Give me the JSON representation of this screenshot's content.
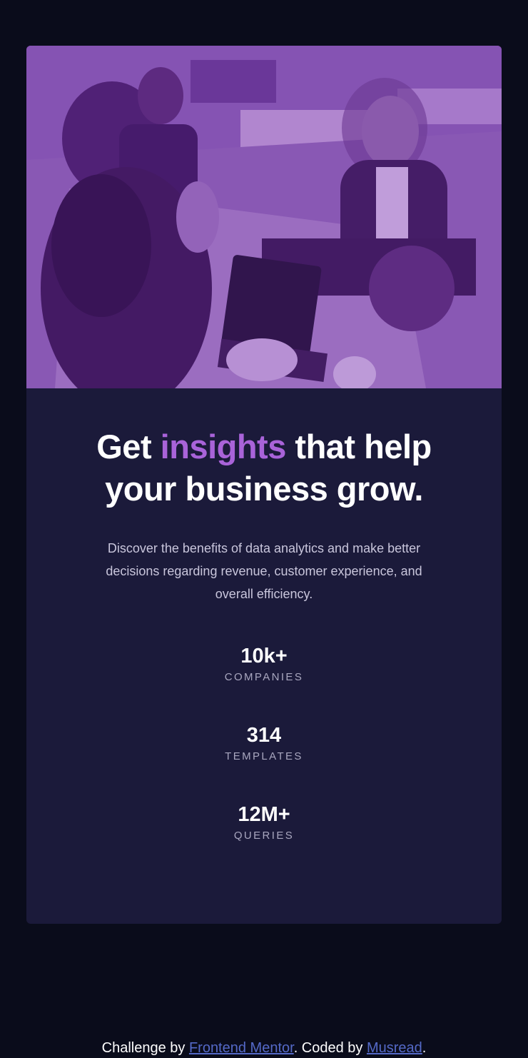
{
  "hero": {
    "alt": "Team working at a shared desk with laptops"
  },
  "headline": {
    "part1": "Get ",
    "accent": "insights",
    "part2": " that help your business grow."
  },
  "description": "Discover the benefits of data analytics and make better decisions regarding revenue, customer experience, and overall efficiency.",
  "stats": [
    {
      "value": "10k+",
      "label": "COMPANIES"
    },
    {
      "value": "314",
      "label": "TEMPLATES"
    },
    {
      "value": "12M+",
      "label": "QUERIES"
    }
  ],
  "footer": {
    "prefix": "Challenge by ",
    "link1": "Frontend Mentor",
    "middle": ". Coded by ",
    "link2": "Musread",
    "suffix": "."
  },
  "colors": {
    "page_bg": "#0a0c1b",
    "card_bg": "#1b1a3a",
    "accent": "#a963d9",
    "link": "#5469c7"
  }
}
